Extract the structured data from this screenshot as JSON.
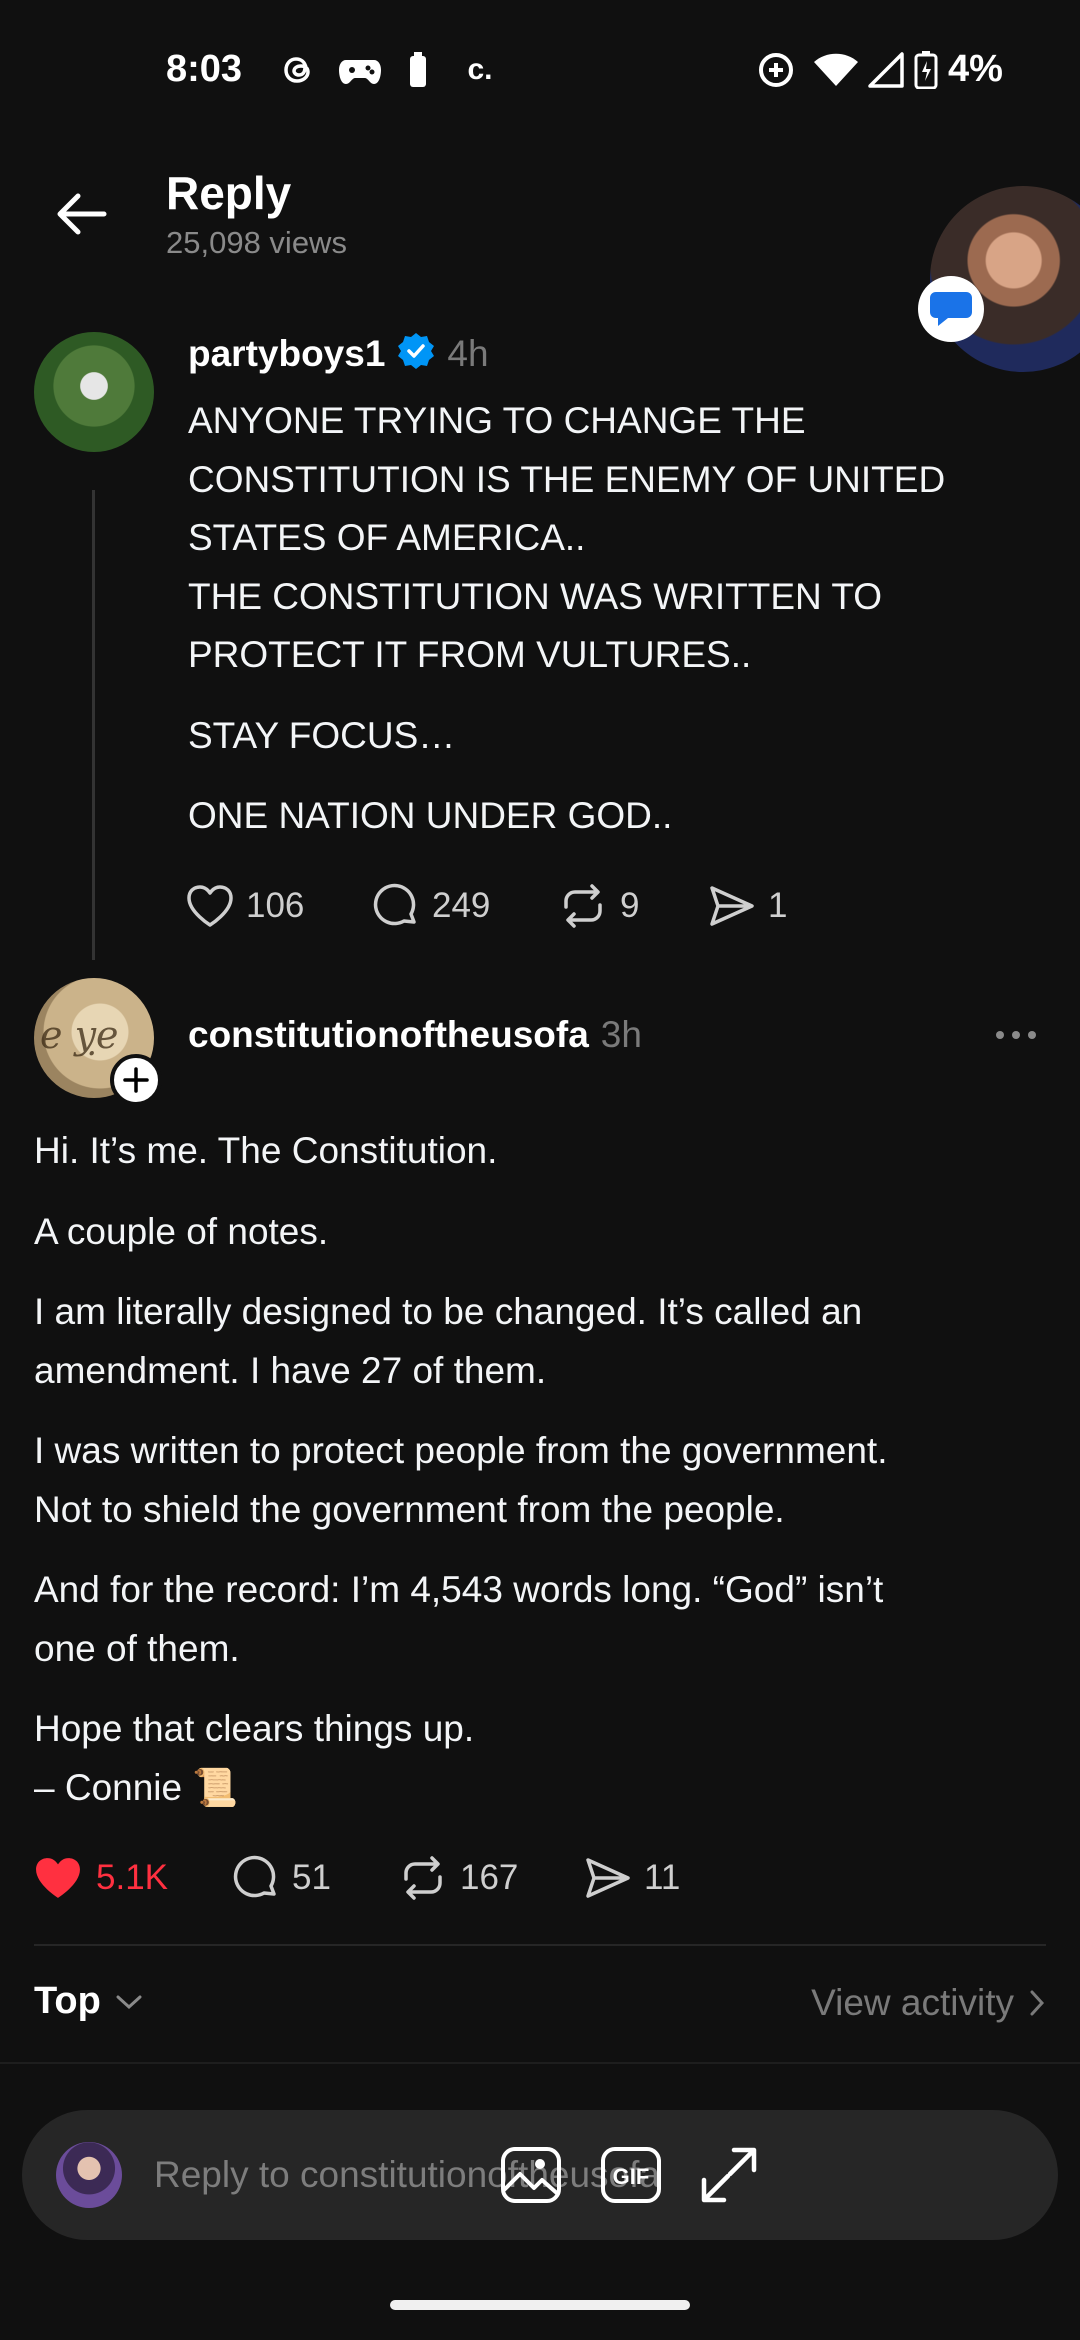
{
  "status_bar": {
    "time": "8:03",
    "carrier_glyph": "c.",
    "battery": "4%",
    "icons": [
      "threads-icon",
      "gamepad-icon",
      "battery-small-icon",
      "data-saver-icon",
      "wifi-icon",
      "signal-icon",
      "battery-charging-icon"
    ]
  },
  "header": {
    "title": "Reply",
    "views": "25,098 views"
  },
  "post1": {
    "username": "partyboys1",
    "verified": true,
    "time": "4h",
    "paragraphs": [
      "ANYONE TRYING TO CHANGE THE CONSTITUTION IS THE ENEMY OF UNITED STATES OF AMERICA.. THE CONSTITUTION WAS WRITTEN TO PROTECT IT FROM VULTURES..",
      "STAY FOCUS…",
      "ONE NATION UNDER GOD.."
    ],
    "lines": [
      "ANYONE TRYING TO CHANGE THE",
      "CONSTITUTION IS THE ENEMY OF UNITED",
      "STATES OF AMERICA..",
      "THE CONSTITUTION WAS WRITTEN TO",
      "PROTECT IT FROM VULTURES.."
    ],
    "likes": "106",
    "comments": "249",
    "reposts": "9",
    "shares": "1"
  },
  "post2": {
    "username": "constitutionoftheusofa",
    "time": "3h",
    "p1": "Hi. It’s me. The Constitution.",
    "p2": "A couple of notes.",
    "p3a": "I am literally designed to be changed. It’s called an",
    "p3b": "amendment. I have 27 of them.",
    "p4a": "I was written to protect people from the government.",
    "p4b": "Not to shield the government from the people.",
    "p5a": "And for the record: I’m 4,543 words long. “God” isn’t",
    "p5b": "one of them.",
    "p6a": "Hope that clears things up.",
    "p6b": "– Connie 📜",
    "likes": "5.1K",
    "comments": "51",
    "reposts": "167",
    "shares": "11",
    "liked": true
  },
  "sort": {
    "label": "Top",
    "view_activity": "View activity"
  },
  "composer": {
    "placeholder": "Reply to constitutionoftheusofa"
  },
  "colors": {
    "background": "#101010",
    "like_red": "#ff3040",
    "verified_blue": "#0095f6",
    "muted": "#7a7a7a"
  }
}
